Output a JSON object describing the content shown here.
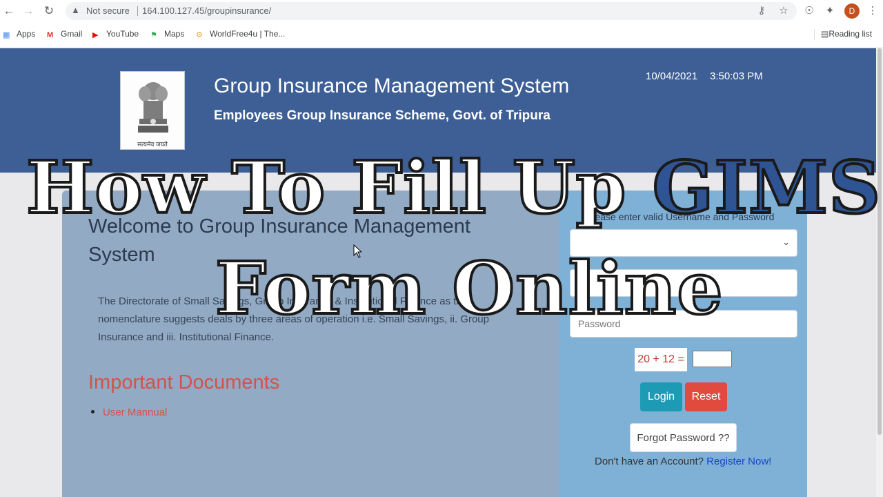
{
  "browser": {
    "address_warning": "Not secure",
    "url": "164.100.127.45/groupinsurance/",
    "profile_initial": "D",
    "bookmarks": [
      "Apps",
      "Gmail",
      "YouTube",
      "Maps",
      "WorldFree4u | The..."
    ],
    "reading_list": "Reading list"
  },
  "header": {
    "title": "Group Insurance Management System",
    "subtitle": "Employees Group Insurance Scheme, Govt. of Tripura",
    "date": "10/04/2021",
    "time": "3:50:03 PM",
    "emblem_motto": "सत्यमेव जयते"
  },
  "main": {
    "welcome": "Welcome to Group Insurance Management System",
    "intro": "The Directorate of Small Savings, Group Insurance & Institutional Finance as the nomenclature suggests deals by three areas of operation i.e. Small Savings, ii. Group Insurance and iii. Institutional Finance.",
    "documents_title": "Important Documents",
    "documents": [
      "User Mannual"
    ]
  },
  "login": {
    "hint": "Please enter valid Username and Password",
    "password_placeholder": "Password",
    "captcha": "20 + 12 =",
    "login_label": "Login",
    "reset_label": "Reset",
    "forgot_label": "Forgot Password ??",
    "register_prompt": "Don't have an Account?",
    "register_link": "Register Now!"
  },
  "overlay": {
    "line1_prefix": "How To Fill Up",
    "line1_highlight": "GIMS",
    "line2": "Form Online"
  },
  "colors": {
    "header_bg": "#3d5f96",
    "content_bg": "#92aac4",
    "login_bg": "#7fb0d6",
    "login_button": "#1d9bb5",
    "reset_button": "#e04b3e",
    "accent_red": "#d4524c",
    "link_blue": "#1546c9"
  }
}
